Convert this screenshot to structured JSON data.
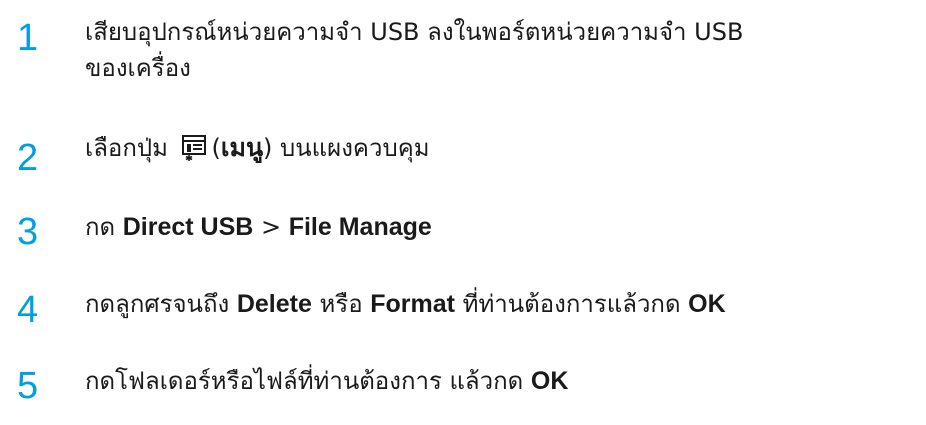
{
  "steps": [
    {
      "number": "1",
      "line1": "เสียบอุปกรณ์หน่วยความจำ USB ลงในพอร์ตหน่วยความจำ USB",
      "line2": "ของเครื่อง"
    },
    {
      "number": "2",
      "before": "เลือกปุ่ม ",
      "open_paren": "(",
      "menu_label": "เมนู",
      "after": ") บนแผงควบคุม",
      "icon": "menu-icon"
    },
    {
      "number": "3",
      "before": "กด ",
      "path": "Direct USB",
      "sep": " > ",
      "item": "File Manage"
    },
    {
      "number": "4",
      "before": "กดลูกศรจนถึง ",
      "opt1": "Delete",
      "mid": " หรือ ",
      "opt2": "Format",
      "after": " ที่ท่านต้องการแล้วกด ",
      "ok": "OK"
    },
    {
      "number": "5",
      "before": "กดโฟลเดอร์หรือไฟล์ที่ท่านต้องการ แล้วกด ",
      "ok": "OK"
    }
  ],
  "colors": {
    "step_number": "#00a0e0",
    "text": "#1a1a1a"
  }
}
